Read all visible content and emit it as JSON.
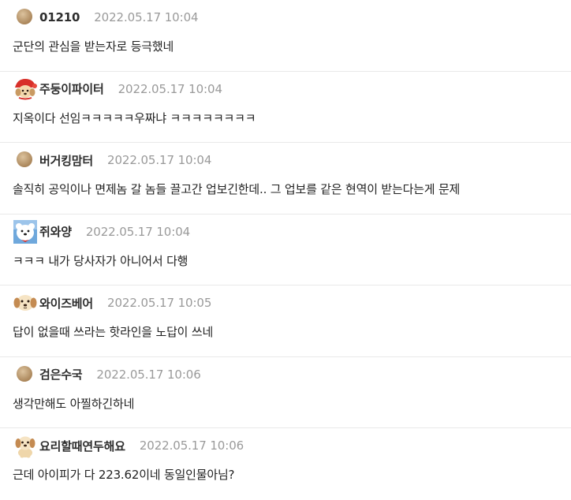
{
  "comments": [
    {
      "avatar": "default-dot-icon",
      "nickname": "01210",
      "date": "2022.05.17 10:04",
      "text": "군단의 관심을 받는자로 등극했네"
    },
    {
      "avatar": "puppy-red-hat-icon",
      "nickname": "주둥이파이터",
      "date": "2022.05.17 10:04",
      "text": "지옥이다 선임ㅋㅋㅋㅋㅋ우짜냐 ㅋㅋㅋㅋㅋㅋㅋㅋ"
    },
    {
      "avatar": "default-dot-icon",
      "nickname": "버거킹맘터",
      "date": "2022.05.17 10:04",
      "text": "솔직히 공익이나 면제놈 갈 놈들 끌고간 업보긴한데.. 그 업보를 같은 현역이 받는다는게 문제"
    },
    {
      "avatar": "polar-bear-icon",
      "nickname": "쥐와양",
      "date": "2022.05.17 10:04",
      "text": "ㅋㅋㅋ 내가 당사자가 아니어서 다행"
    },
    {
      "avatar": "puppy-face-icon",
      "nickname": "와이즈베어",
      "date": "2022.05.17 10:05",
      "text": "답이 없을때 쓰라는 핫라인을 노답이 쓰네"
    },
    {
      "avatar": "default-dot-icon",
      "nickname": "검은수국",
      "date": "2022.05.17 10:06",
      "text": "생각만해도 아찔하긴하네"
    },
    {
      "avatar": "puppy-sitting-icon",
      "nickname": "요리할때연두해요",
      "date": "2022.05.17 10:06",
      "text": "근데 아이피가 다 223.62이네 동일인물아님?"
    }
  ],
  "colors": {
    "nickname": "#2d2d2d",
    "date": "#9a9a9a",
    "text": "#222222",
    "divider": "#e9e9e9",
    "default_avatar": "#c8a97e"
  }
}
